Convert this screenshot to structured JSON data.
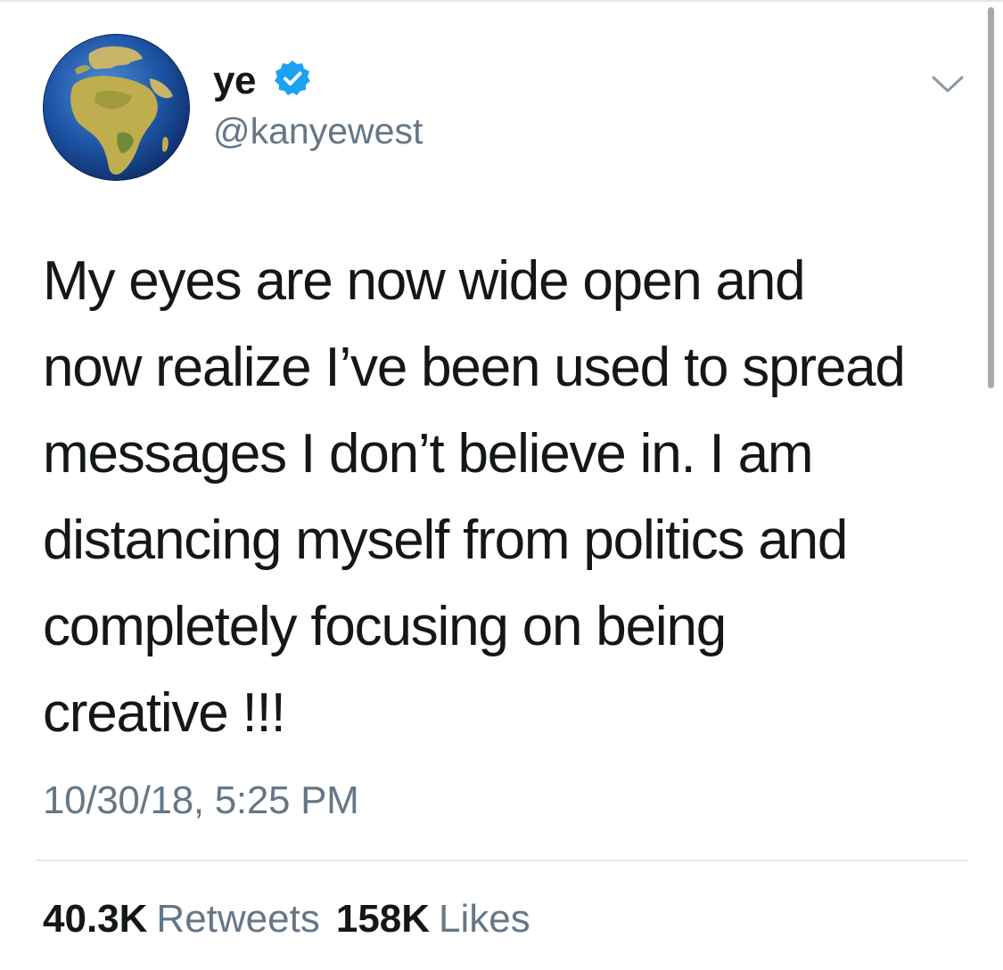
{
  "user": {
    "display_name": "ye",
    "handle": "@kanyewest",
    "verified": true,
    "avatar_icon": "globe-africa-europe-icon"
  },
  "tweet": {
    "lines": [
      "My eyes are now wide open and",
      "now realize I’ve been used to spread",
      "messages I don’t believe in. I am",
      "distancing myself from politics and",
      "completely focusing on being",
      "creative !!!"
    ],
    "timestamp": "10/30/18, 5:25 PM"
  },
  "stats": {
    "retweets_count": "40.3K",
    "retweets_label": "Retweets",
    "likes_count": "158K",
    "likes_label": "Likes"
  },
  "colors": {
    "text_primary": "#14171a",
    "text_secondary": "#657786",
    "verified_blue": "#1da1f2",
    "divider": "#e1e8ed"
  },
  "icons": {
    "menu": "chevron-down-icon",
    "verified": "verified-badge-icon"
  }
}
